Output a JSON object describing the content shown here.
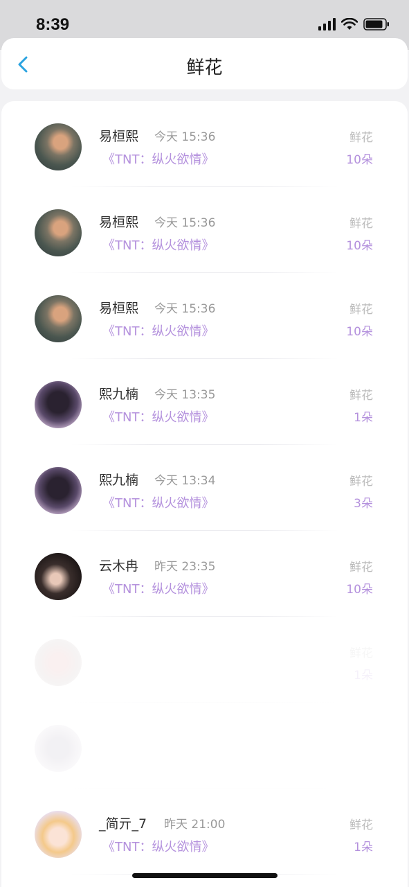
{
  "status_bar": {
    "time": "8:39"
  },
  "nav": {
    "title": "鲜花"
  },
  "records": [
    {
      "name": "易桓熙",
      "time": "今天 15:36",
      "work": "《TNT：纵火欲情》",
      "gift": "鲜花",
      "count": "10朵"
    },
    {
      "name": "易桓熙",
      "time": "今天 15:36",
      "work": "《TNT：纵火欲情》",
      "gift": "鲜花",
      "count": "10朵"
    },
    {
      "name": "易桓熙",
      "time": "今天 15:36",
      "work": "《TNT：纵火欲情》",
      "gift": "鲜花",
      "count": "10朵"
    },
    {
      "name": "熙九楠",
      "time": "今天 13:35",
      "work": "《TNT：纵火欲情》",
      "gift": "鲜花",
      "count": "1朵"
    },
    {
      "name": "熙九楠",
      "time": "今天 13:34",
      "work": "《TNT：纵火欲情》",
      "gift": "鲜花",
      "count": "3朵"
    },
    {
      "name": "云木冉",
      "time": "昨天 23:35",
      "work": "《TNT：纵火欲情》",
      "gift": "鲜花",
      "count": "10朵"
    },
    {
      "name": "",
      "time": "",
      "work": "",
      "gift": "鲜花",
      "count": "1朵"
    },
    {
      "name": "",
      "time": "",
      "work": "",
      "gift": "",
      "count": ""
    },
    {
      "name": "_简亓_7",
      "time": "昨天 21:00",
      "work": "《TNT：纵火欲情》",
      "gift": "鲜花",
      "count": "1朵"
    }
  ],
  "colors": {
    "accent": "#b491dd",
    "back": "#2aa3e0"
  }
}
